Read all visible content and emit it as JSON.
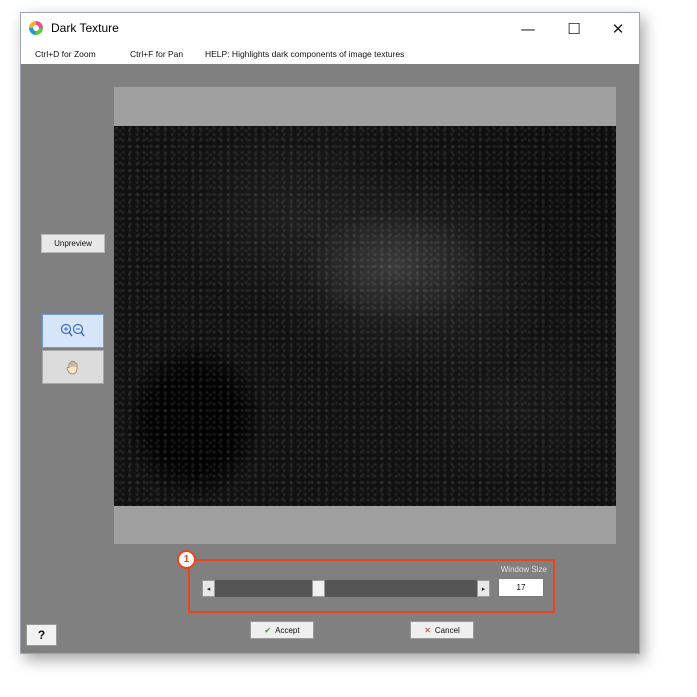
{
  "window": {
    "title": "Dark Texture",
    "controls": {
      "minimize": "—",
      "maximize": "☐",
      "close": "✕"
    }
  },
  "menubar": {
    "zoom_hint": "Ctrl+D for Zoom",
    "pan_hint": "Ctrl+F for Pan",
    "help_text": "HELP:  Highlights dark components of image textures"
  },
  "sidebar": {
    "unpreview_label": "Unpreview",
    "zoom_icon": "zoom-in-out-icon",
    "pan_icon": "hand-pan-icon"
  },
  "slider": {
    "callout_number": "1",
    "label": "Window Size",
    "value": "17",
    "thumb_fraction": 0.39,
    "left_arrow": "◂",
    "right_arrow": "▸"
  },
  "actions": {
    "accept_label": "Accept",
    "accept_icon": "✔",
    "cancel_label": "Cancel",
    "cancel_icon": "✕",
    "help_label": "?"
  },
  "colors": {
    "highlight": "#e8451e",
    "accept_check": "#3a9a2a",
    "cancel_x": "#d42a2a"
  }
}
